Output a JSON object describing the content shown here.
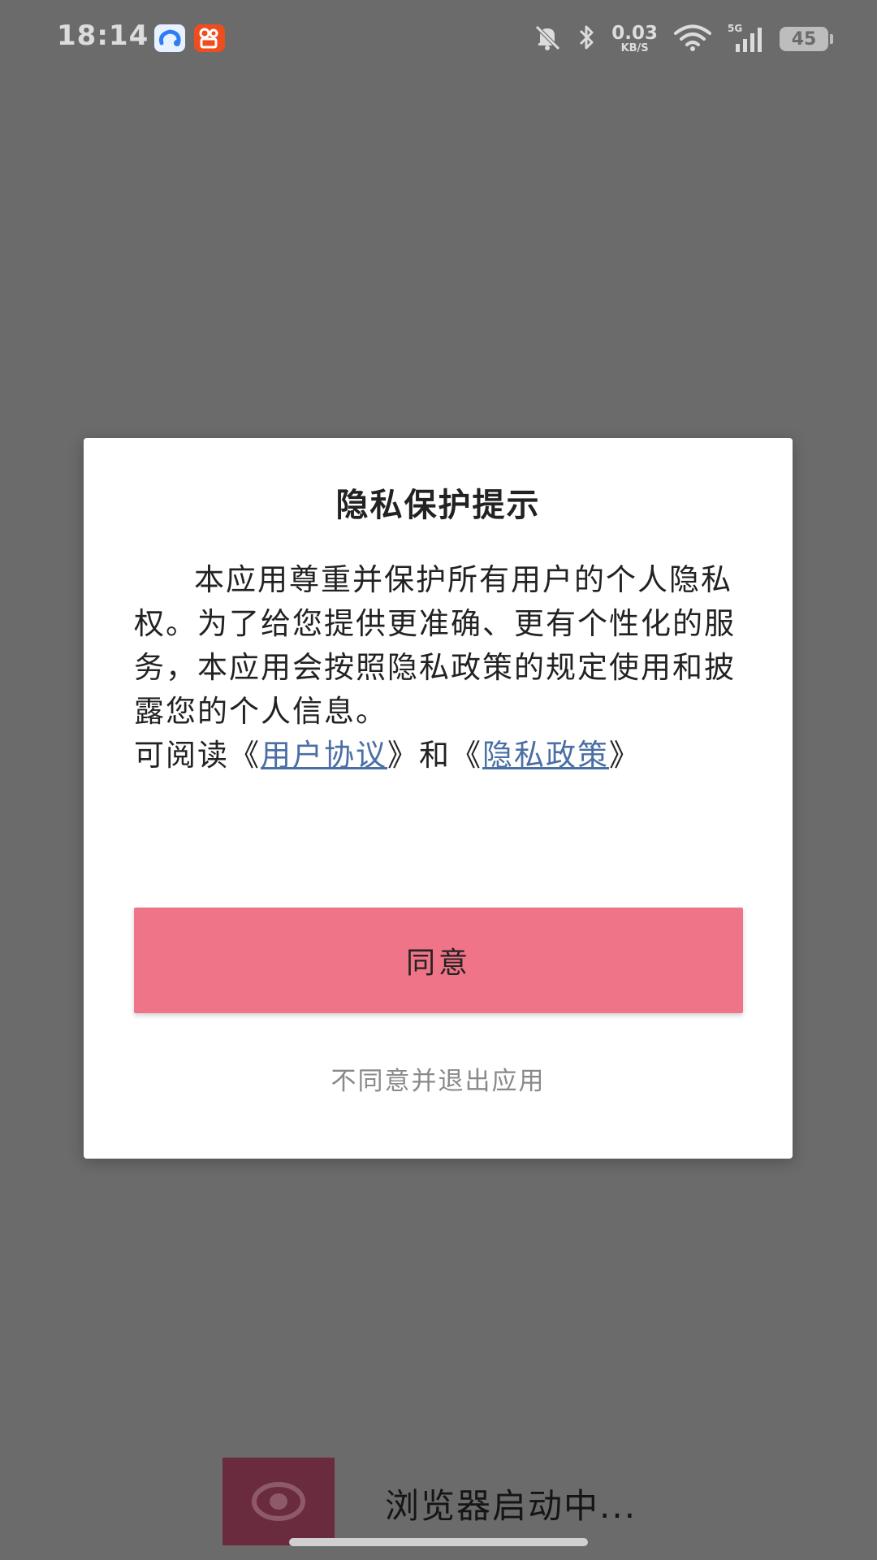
{
  "status_bar": {
    "time": "18:14",
    "net_speed_value": "0.03",
    "net_speed_unit": "KB/S",
    "network_label": "5G",
    "battery_level": "45",
    "icons": [
      "cloud-app-icon",
      "kuaishou-app-icon",
      "bell-muted-icon",
      "bluetooth-icon",
      "wifi-icon",
      "signal-icon",
      "battery-icon"
    ]
  },
  "dialog": {
    "title": "隐私保护提示",
    "body": "本应用尊重并保护所有用户的个人隐私权。为了给您提供更准确、更有个性化的服务，本应用会按照隐私政策的规定使用和披露您的个人信息。",
    "read_prefix": "可阅读《",
    "user_agreement_link": "用户协议",
    "middle_text": "》和《",
    "privacy_policy_link": "隐私政策",
    "read_suffix": "》",
    "agree_label": "同意",
    "decline_label": "不同意并退出应用"
  },
  "loading": {
    "text": "浏览器启动中..."
  },
  "colors": {
    "overlay": "#6b6b6b",
    "agree_button": "#f07488",
    "link": "#4a6fa5",
    "toast_icon_bg": "#6a2b3e"
  }
}
